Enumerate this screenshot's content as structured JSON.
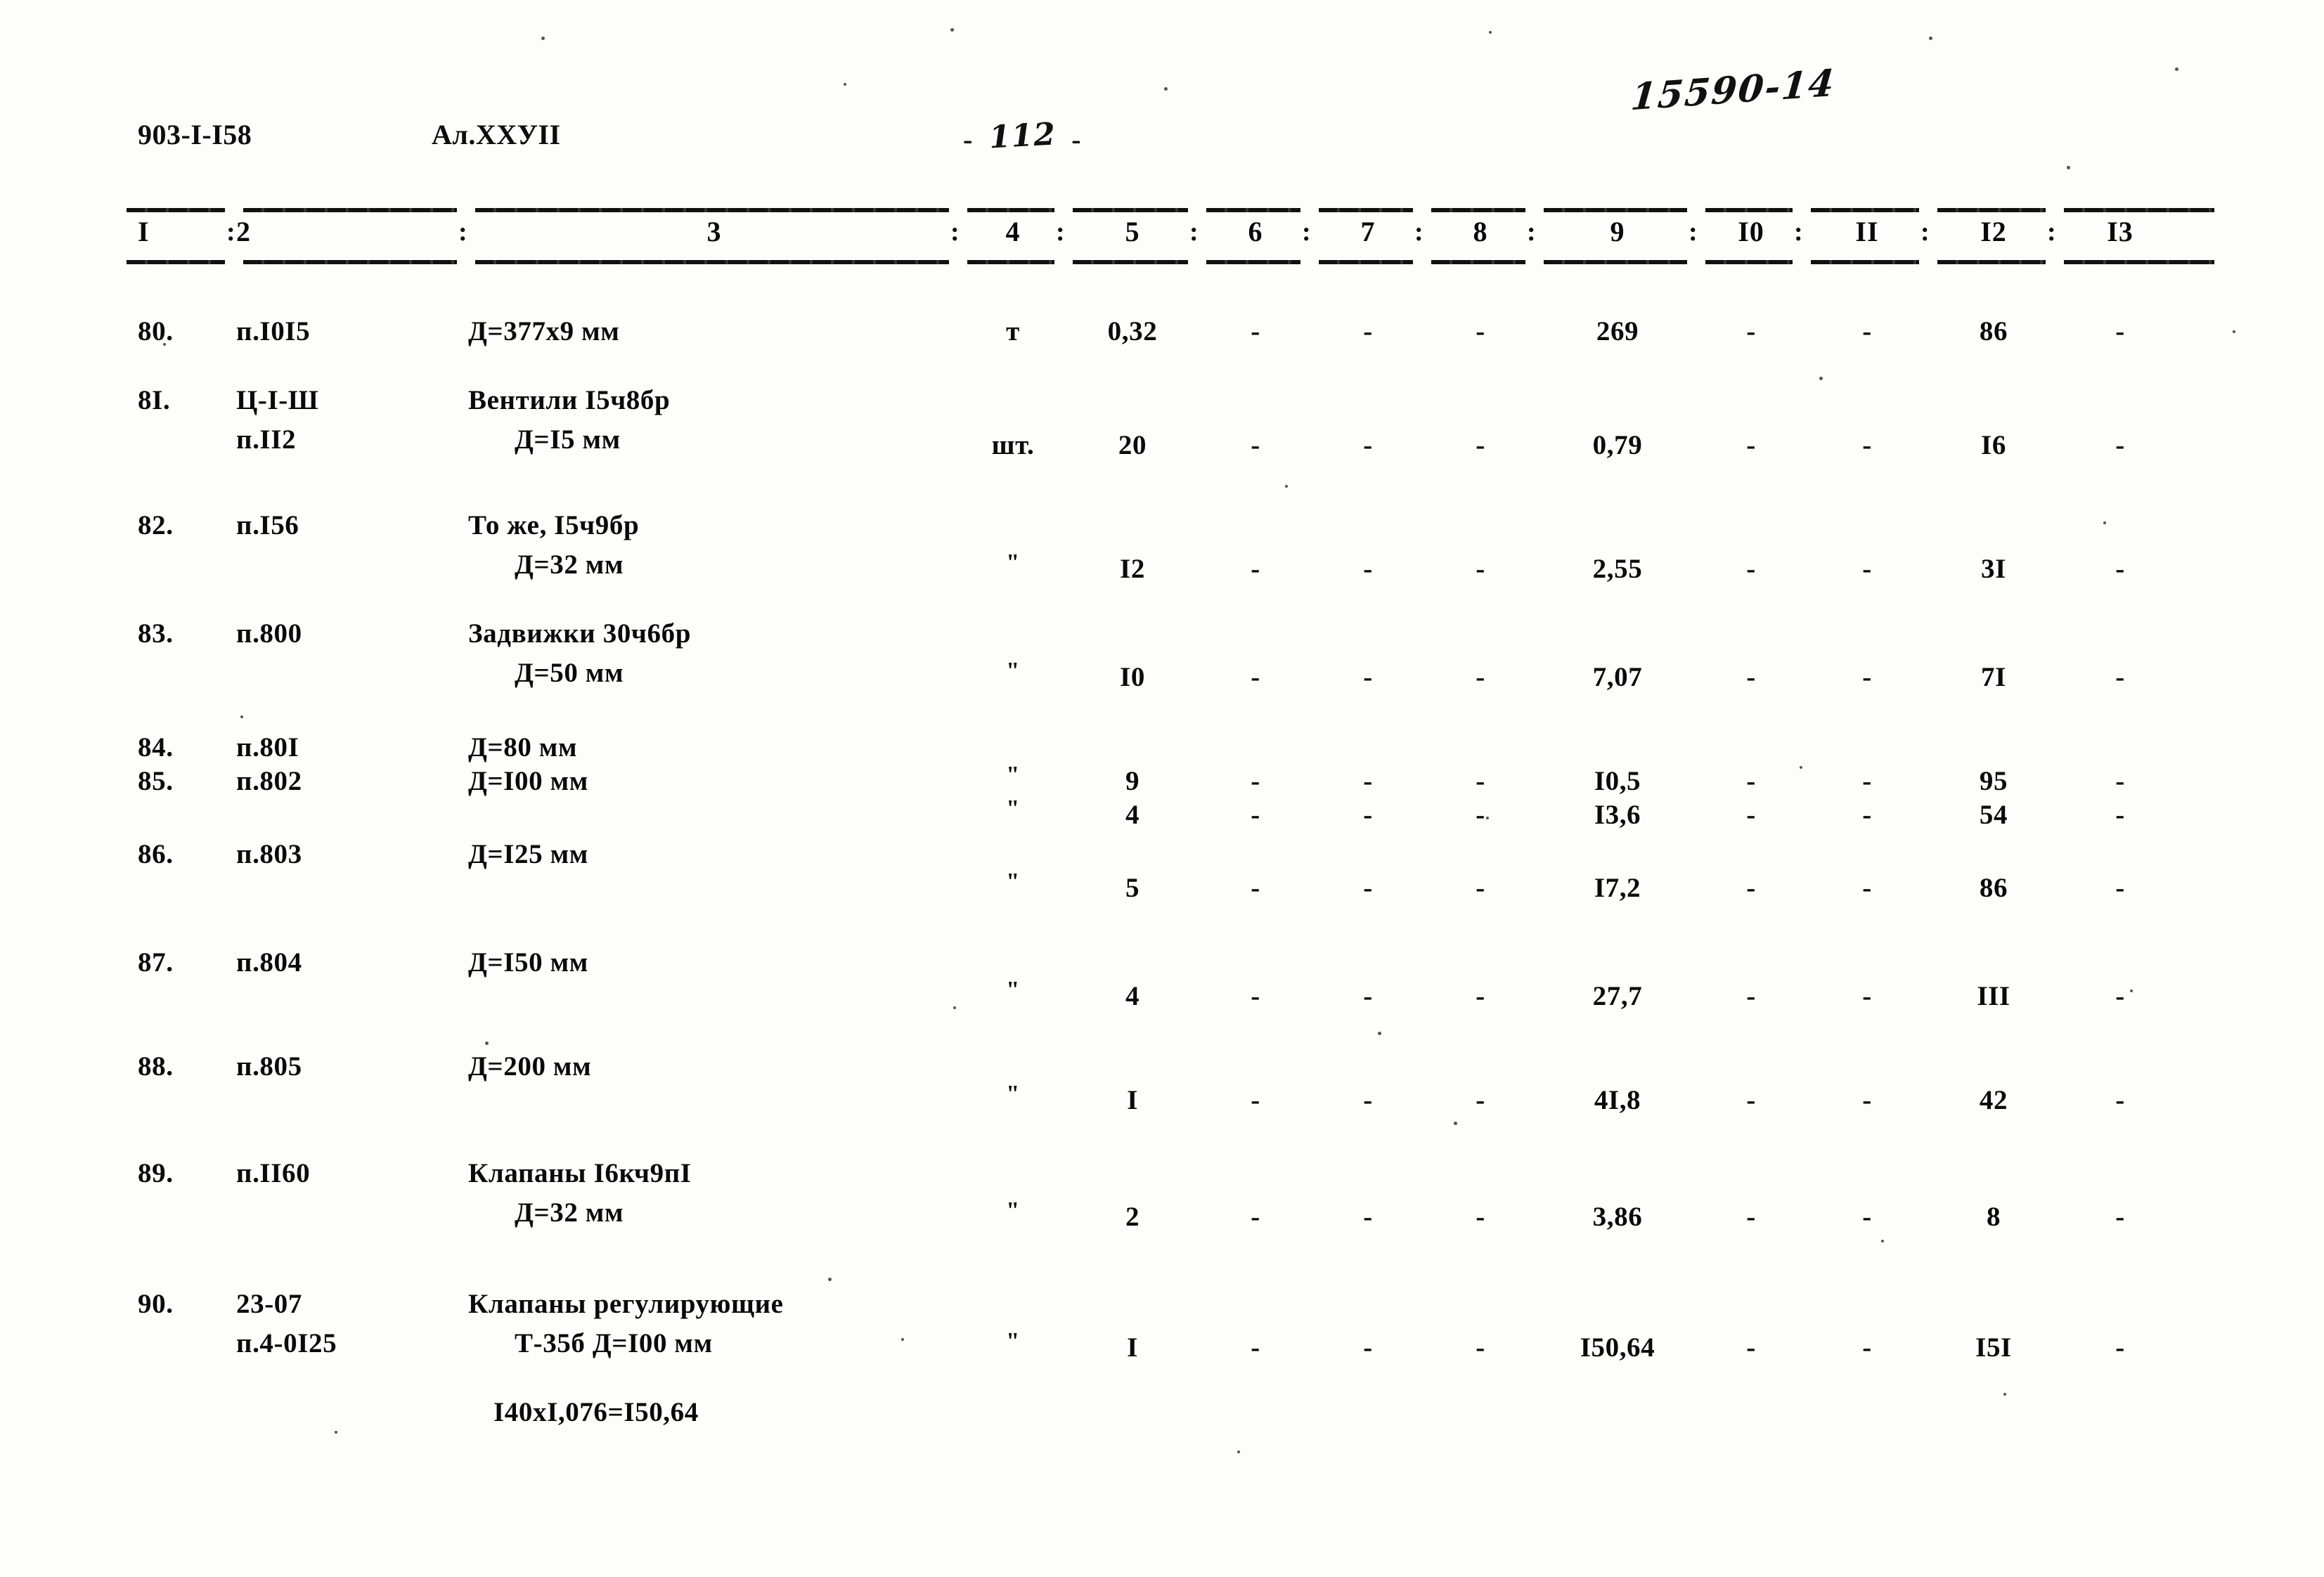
{
  "header": {
    "doc_code": "903-I-I58",
    "album": "Ал.ХХУII",
    "page_dash_left": "-",
    "page_number": "112",
    "page_dash_right": "-",
    "archive_stamp": "15590-14"
  },
  "table": {
    "column_headers": [
      "I",
      "2",
      "3",
      "4",
      "5",
      "6",
      "7",
      "8",
      "9",
      "I0",
      "II",
      "I2",
      "I3"
    ],
    "separator": ":",
    "rows": [
      {
        "num": "80.",
        "code_lines": [
          "п.I0I5"
        ],
        "desc_lines": [
          "Д=377х9 мм"
        ],
        "unit": "т",
        "qty": "0,32",
        "c6": "-",
        "c7": "-",
        "c8": "-",
        "c9": "269",
        "c10": "-",
        "c11": "-",
        "c12": "86",
        "c13": "-"
      },
      {
        "num": "8I.",
        "code_lines": [
          "Ц-I-Ш",
          "п.II2"
        ],
        "desc_lines": [
          "Вентили I5ч8бр",
          "Д=I5 мм"
        ],
        "unit": "шт.",
        "qty": "20",
        "c6": "-",
        "c7": "-",
        "c8": "-",
        "c9": "0,79",
        "c10": "-",
        "c11": "-",
        "c12": "I6",
        "c13": "-"
      },
      {
        "num": "82.",
        "code_lines": [
          "п.I56"
        ],
        "desc_lines": [
          "То же, I5ч9бр",
          "Д=32 мм"
        ],
        "unit": "\"",
        "qty": "I2",
        "c6": "-",
        "c7": "-",
        "c8": "-",
        "c9": "2,55",
        "c10": "-",
        "c11": "-",
        "c12": "3I",
        "c13": "-"
      },
      {
        "num": "83.",
        "code_lines": [
          "п.800"
        ],
        "desc_lines": [
          "Задвижки 30ч6бр",
          "Д=50 мм"
        ],
        "unit": "\"",
        "qty": "I0",
        "c6": "-",
        "c7": "-",
        "c8": "-",
        "c9": "7,07",
        "c10": "-",
        "c11": "-",
        "c12": "7I",
        "c13": "-"
      },
      {
        "num": "84.",
        "code_lines": [
          "п.80I"
        ],
        "desc_lines": [
          "Д=80 мм"
        ],
        "unit": "\"",
        "qty": "9",
        "c6": "-",
        "c7": "-",
        "c8": "-",
        "c9": "I0,5",
        "c10": "-",
        "c11": "-",
        "c12": "95",
        "c13": "-"
      },
      {
        "num": "85.",
        "code_lines": [
          "п.802"
        ],
        "desc_lines": [
          "Д=I00 мм"
        ],
        "unit": "\"",
        "qty": "4",
        "c6": "-",
        "c7": "-",
        "c8": "-",
        "c9": "I3,6",
        "c10": "-",
        "c11": "-",
        "c12": "54",
        "c13": "-"
      },
      {
        "num": "86.",
        "code_lines": [
          "п.803"
        ],
        "desc_lines": [
          "Д=I25 мм"
        ],
        "unit": "\"",
        "qty": "5",
        "c6": "-",
        "c7": "-",
        "c8": "-",
        "c9": "I7,2",
        "c10": "-",
        "c11": "-",
        "c12": "86",
        "c13": "-"
      },
      {
        "num": "87.",
        "code_lines": [
          "п.804"
        ],
        "desc_lines": [
          "Д=I50 мм"
        ],
        "unit": "\"",
        "qty": "4",
        "c6": "-",
        "c7": "-",
        "c8": "-",
        "c9": "27,7",
        "c10": "-",
        "c11": "-",
        "c12": "III",
        "c13": "-"
      },
      {
        "num": "88.",
        "code_lines": [
          "п.805"
        ],
        "desc_lines": [
          "Д=200 мм"
        ],
        "unit": "\"",
        "qty": "I",
        "c6": "-",
        "c7": "-",
        "c8": "-",
        "c9": "4I,8",
        "c10": "-",
        "c11": "-",
        "c12": "42",
        "c13": "-"
      },
      {
        "num": "89.",
        "code_lines": [
          "п.II60"
        ],
        "desc_lines": [
          "Клапаны I6кч9пI",
          "Д=32 мм"
        ],
        "unit": "\"",
        "qty": "2",
        "c6": "-",
        "c7": "-",
        "c8": "-",
        "c9": "3,86",
        "c10": "-",
        "c11": "-",
        "c12": "8",
        "c13": "-"
      },
      {
        "num": "90.",
        "code_lines": [
          "23-07",
          "п.4-0I25"
        ],
        "desc_lines": [
          "Клапаны регулирующие",
          "Т-35б Д=I00 мм"
        ],
        "unit": "\"",
        "qty": "I",
        "c6": "-",
        "c7": "-",
        "c8": "-",
        "c9": "I50,64",
        "c10": "-",
        "c11": "-",
        "c12": "I5I",
        "c13": "-"
      }
    ],
    "footnote": "I40хI,076=I50,64"
  }
}
